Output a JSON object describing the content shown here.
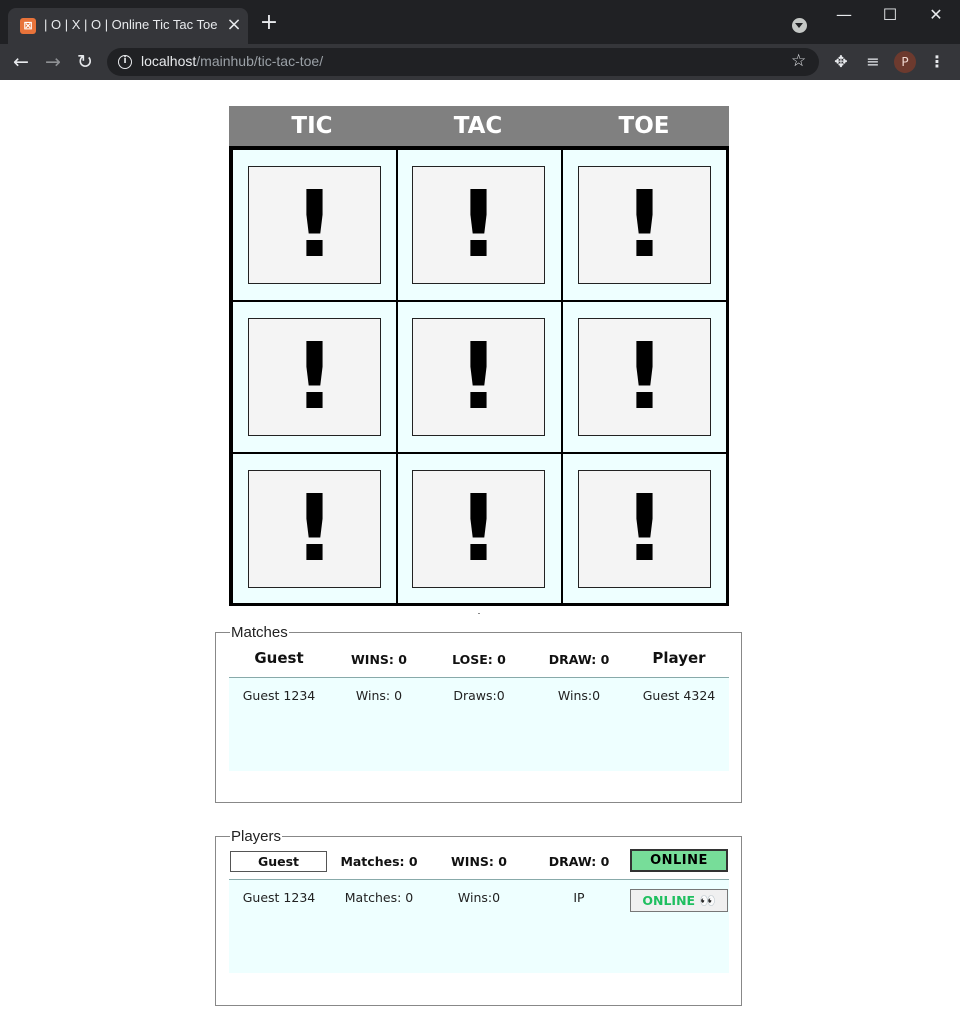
{
  "browser": {
    "tab_title": "| O | X | O | Online Tic Tac Toe",
    "url_host": "localhost",
    "url_path": "/mainhub/tic-tac-toe/",
    "avatar_letter": "P"
  },
  "board": {
    "headers": [
      "TIC",
      "TAC",
      "TOE"
    ],
    "cells": [
      "!",
      "!",
      "!",
      "!",
      "!",
      "!",
      "!",
      "!",
      "!"
    ]
  },
  "matches": {
    "legend": "Matches",
    "headers": [
      "Guest",
      "WINS: 0",
      "LOSE: 0",
      "DRAW: 0",
      "Player"
    ],
    "row": [
      "Guest 1234",
      "Wins: 0",
      "Draws:0",
      "Wins:0",
      "Guest 4324"
    ]
  },
  "players": {
    "legend": "Players",
    "guest_button": "Guest",
    "headers": [
      "Matches: 0",
      "WINS: 0",
      "DRAW: 0"
    ],
    "online_button": "ONLINE",
    "row": [
      "Guest 1234",
      "Matches: 0",
      "Wins:0",
      "IP"
    ],
    "status_badge": "ONLINE",
    "status_emoji": "👀"
  },
  "colors": {
    "board_bg": "#eeffff",
    "header_bg": "#808080",
    "online_green": "#77dd99"
  }
}
